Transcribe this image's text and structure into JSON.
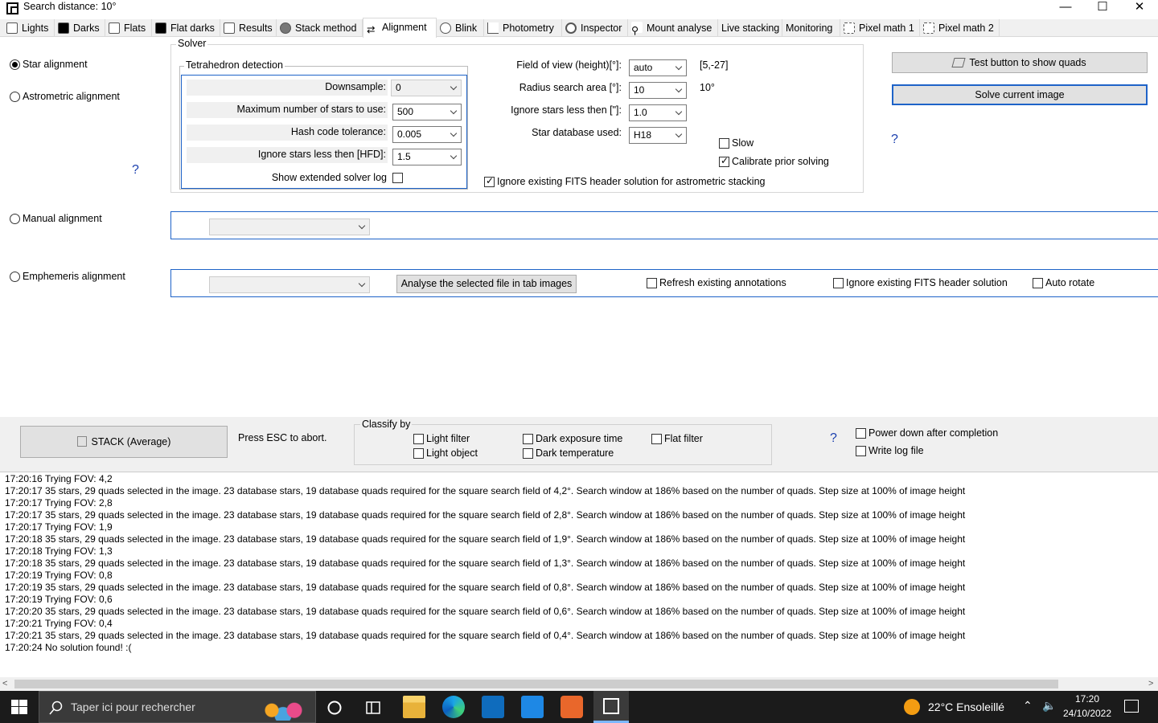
{
  "window": {
    "title": "Search distance:  10°",
    "minimize": "—",
    "maximize": "☐",
    "close": "✕"
  },
  "tabs": [
    {
      "label": "Lights",
      "icon": "lights-icon"
    },
    {
      "label": "Darks",
      "icon": "darks-icon"
    },
    {
      "label": "Flats",
      "icon": "flats-icon"
    },
    {
      "label": "Flat darks",
      "icon": "flat-darks-icon"
    },
    {
      "label": "Results",
      "icon": "results-icon"
    },
    {
      "label": "Stack method",
      "icon": "stack-method-icon"
    },
    {
      "label": "Alignment",
      "icon": "alignment-icon"
    },
    {
      "label": "Blink",
      "icon": "blink-icon"
    },
    {
      "label": "Photometry",
      "icon": "photometry-icon"
    },
    {
      "label": "Inspector",
      "icon": "inspector-icon"
    },
    {
      "label": "Mount analyse",
      "icon": "mount-icon"
    },
    {
      "label": "Live stacking",
      "icon": ""
    },
    {
      "label": "Monitoring",
      "icon": ""
    },
    {
      "label": "Pixel math 1",
      "icon": "pixel-math-icon"
    },
    {
      "label": "Pixel math 2",
      "icon": "pixel-math-icon"
    }
  ],
  "alignment": {
    "star_alignment": "Star alignment",
    "astrometric_alignment": "Astrometric alignment",
    "manual_alignment": "Manual alignment",
    "ephemeris_alignment": "Emphemeris alignment",
    "help": "?"
  },
  "solver": {
    "group_label": "Solver",
    "tetra_label": "Tetrahedron detection",
    "downsample_label": "Downsample:",
    "downsample_value": "0",
    "max_stars_label": "Maximum number of stars to use:",
    "max_stars_value": "500",
    "hash_label": "Hash code tolerance:",
    "hash_value": "0.005",
    "ignore_hfd_label": "Ignore stars less then [HFD]:",
    "ignore_hfd_value": "1.5",
    "extended_log_label": "Show extended solver log",
    "fov_label": "Field of view (height)[°]:",
    "fov_value": "auto",
    "fov_range": "[5,-27]",
    "radius_label": "Radius search area  [°]:",
    "radius_value": "10",
    "radius_display": "10°",
    "ignore_stars_label": "Ignore stars less then [\"]:",
    "ignore_stars_value": "1.0",
    "db_label": "Star database used:",
    "db_value": "H18",
    "slow_label": "Slow",
    "calibrate_label": "Calibrate prior solving",
    "ignore_fits_label": "Ignore existing FITS header solution for astrometric stacking"
  },
  "right": {
    "test_button": "Test button to show quads",
    "solve_button": "Solve current image",
    "help": "?"
  },
  "ephemeris": {
    "analyse_button": "Analyse the selected file in tab images",
    "refresh_label": "Refresh existing annotations",
    "ignore_fits_label": "Ignore existing FITS header solution",
    "auto_rotate_label": "Auto rotate"
  },
  "bottom": {
    "stack_button": "STACK  (Average)",
    "esc_text": "Press ESC to abort.",
    "classify_label": "Classify by",
    "light_filter": "Light filter",
    "light_object": "Light object",
    "dark_exposure": "Dark exposure time",
    "dark_temperature": "Dark temperature",
    "flat_filter": "Flat filter",
    "help": "?",
    "power_down": "Power down after completion",
    "write_log": "Write log file"
  },
  "log": [
    "17:20:16  Trying FOV: 4,2",
    "17:20:17  35 stars, 29 quads selected in the image. 23 database stars, 19 database quads required for the square search field of 4,2°. Search window at 186% based on the number of quads. Step size at 100% of image height",
    "17:20:17  Trying FOV: 2,8",
    "17:20:17  35 stars, 29 quads selected in the image. 23 database stars, 19 database quads required for the square search field of 2,8°. Search window at 186% based on the number of quads. Step size at 100% of image height",
    "17:20:17  Trying FOV: 1,9",
    "17:20:18  35 stars, 29 quads selected in the image. 23 database stars, 19 database quads required for the square search field of 1,9°. Search window at 186% based on the number of quads. Step size at 100% of image height",
    "17:20:18  Trying FOV: 1,3",
    "17:20:18  35 stars, 29 quads selected in the image. 23 database stars, 19 database quads required for the square search field of 1,3°. Search window at 186% based on the number of quads. Step size at 100% of image height",
    "17:20:19  Trying FOV: 0,8",
    "17:20:19  35 stars, 29 quads selected in the image. 23 database stars, 19 database quads required for the square search field of 0,8°. Search window at 186% based on the number of quads. Step size at 100% of image height",
    "17:20:19  Trying FOV: 0,6",
    "17:20:20  35 stars, 29 quads selected in the image. 23 database stars, 19 database quads required for the square search field of 0,6°. Search window at 186% based on the number of quads. Step size at 100% of image height",
    "17:20:21  Trying FOV: 0,4",
    "17:20:21  35 stars, 29 quads selected in the image. 23 database stars, 19 database quads required for the square search field of 0,4°. Search window at 186% based on the number of quads. Step size at 100% of image height",
    "17:20:24  No solution found!  :("
  ],
  "taskbar": {
    "search_placeholder": "Taper ici pour rechercher",
    "weather": "22°C  Ensoleillé",
    "time": "17:20",
    "date": "24/10/2022"
  }
}
